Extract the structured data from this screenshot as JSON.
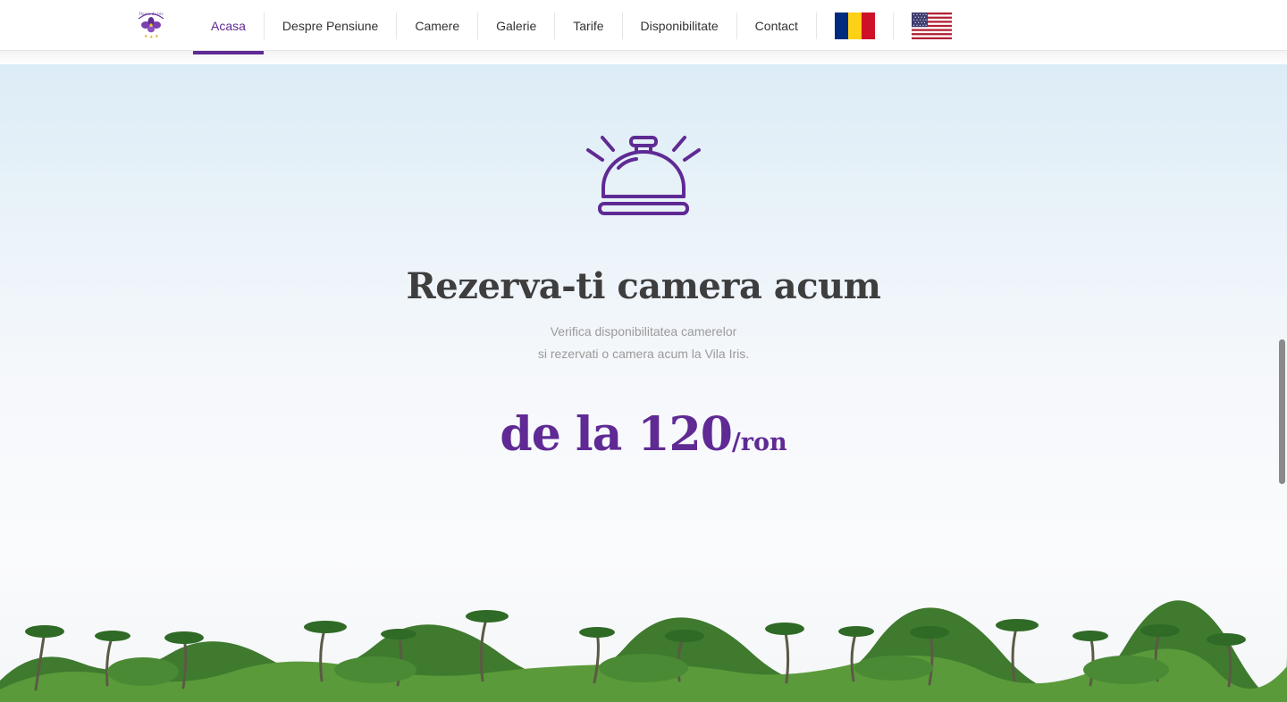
{
  "brand": {
    "logo_icon": "iris-flower-logo",
    "logo_text": "Floare de Iris"
  },
  "nav": {
    "items": [
      {
        "label": "Acasa",
        "active": true
      },
      {
        "label": "Despre Pensiune",
        "active": false
      },
      {
        "label": "Camere",
        "active": false
      },
      {
        "label": "Galerie",
        "active": false
      },
      {
        "label": "Tarife",
        "active": false
      },
      {
        "label": "Disponibilitate",
        "active": false
      },
      {
        "label": "Contact",
        "active": false
      }
    ],
    "languages": [
      {
        "code": "ro",
        "icon": "romania-flag-icon"
      },
      {
        "code": "en",
        "icon": "usa-flag-icon"
      }
    ]
  },
  "hero": {
    "icon": "reception-bell-icon",
    "title": "Rezerva-ti camera acum",
    "subtitle_line1": "Verifica disponibilitatea camerelor",
    "subtitle_line2": "si rezervati o camera acum la Vila Iris.",
    "price_prefix": "de la",
    "price_value": "120",
    "price_unit": "/ron"
  },
  "colors": {
    "accent": "#5f2a94",
    "title": "#3e3e3e",
    "muted": "#9a9a9a"
  }
}
